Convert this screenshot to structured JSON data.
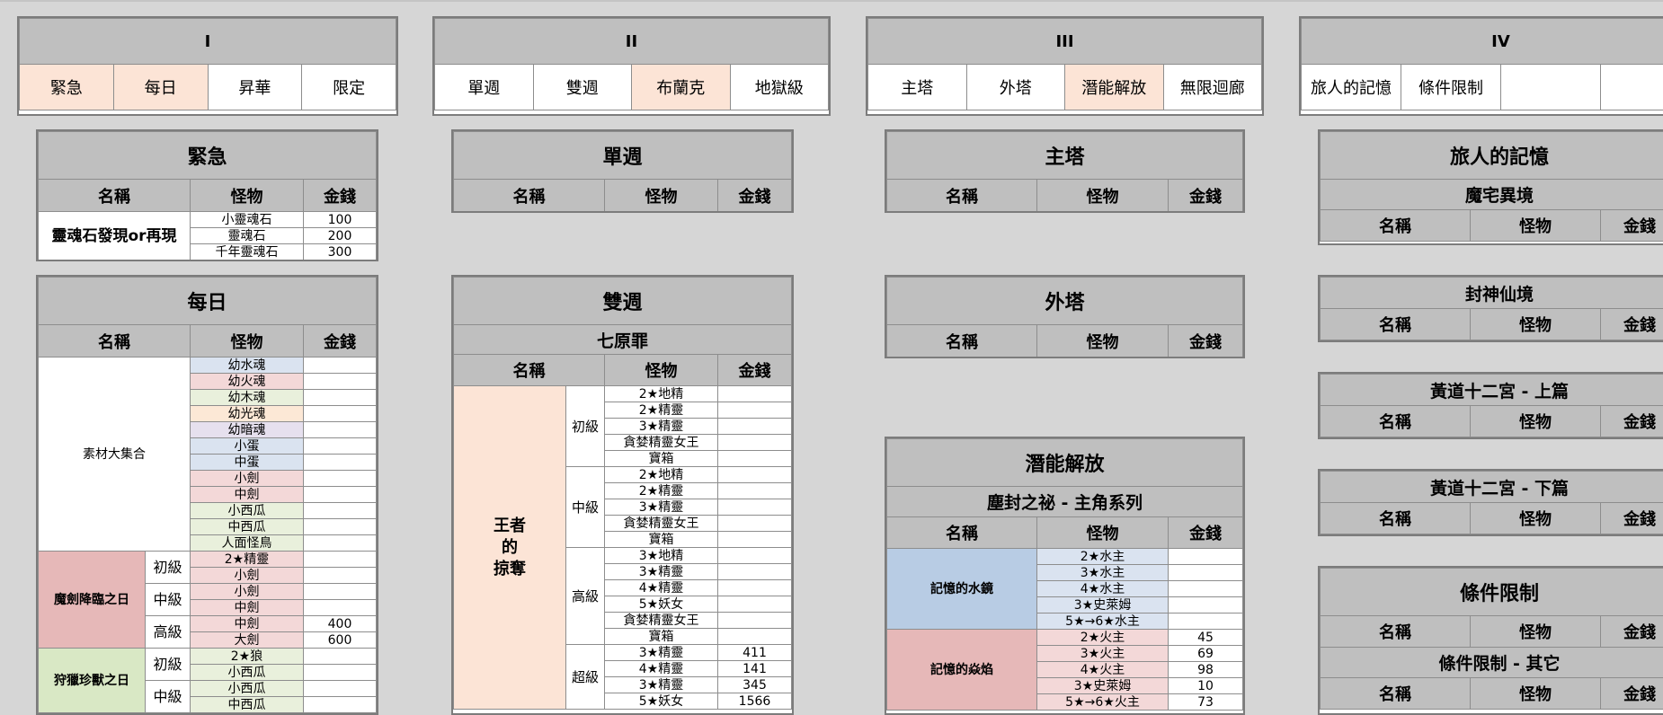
{
  "sections": [
    {
      "title": "I",
      "tabs": [
        "緊急",
        "每日",
        "昇華",
        "限定"
      ]
    },
    {
      "title": "II",
      "tabs": [
        "單週",
        "雙週",
        "布蘭克",
        "地獄級"
      ]
    },
    {
      "title": "III",
      "tabs": [
        "主塔",
        "外塔",
        "潛能解放",
        "無限迴廊"
      ]
    },
    {
      "title": "IV",
      "tabs": [
        "旅人的記憶",
        "條件限制",
        "",
        ""
      ]
    }
  ],
  "columns": {
    "name": "名稱",
    "monster": "怪物",
    "money": "金錢"
  },
  "urgent": {
    "title": "緊急",
    "event": "靈魂石發現or再現",
    "rows": [
      {
        "m": "小靈魂石",
        "v": "100"
      },
      {
        "m": "靈魂石",
        "v": "200"
      },
      {
        "m": "千年靈魂石",
        "v": "300"
      }
    ]
  },
  "daily": {
    "title": "每日",
    "g1": {
      "name": "素材大集合",
      "rows": [
        "幼水魂",
        "幼火魂",
        "幼木魂",
        "幼光魂",
        "幼暗魂",
        "小蛋",
        "中蛋",
        "小劍",
        "中劍",
        "小西瓜",
        "中西瓜",
        "人面怪鳥"
      ]
    },
    "g2": {
      "name": "魔劍降臨之日",
      "levels": [
        {
          "lv": "初級",
          "rows": [
            {
              "m": "2★精靈",
              "v": ""
            },
            {
              "m": "小劍",
              "v": ""
            }
          ]
        },
        {
          "lv": "中級",
          "rows": [
            {
              "m": "小劍",
              "v": ""
            },
            {
              "m": "中劍",
              "v": ""
            }
          ]
        },
        {
          "lv": "高級",
          "rows": [
            {
              "m": "中劍",
              "v": "400"
            },
            {
              "m": "大劍",
              "v": "600"
            }
          ]
        }
      ]
    },
    "g3": {
      "name": "狩獵珍獸之日",
      "levels": [
        {
          "lv": "初級",
          "rows": [
            "2★狼",
            "小西瓜"
          ]
        },
        {
          "lv": "中級",
          "rows": [
            "小西瓜",
            "中西瓜"
          ]
        }
      ]
    }
  },
  "weekly": {
    "title": "單週"
  },
  "biweekly": {
    "title": "雙週",
    "sub": "七原罪",
    "event": "王者\n的\n掠奪",
    "levels": [
      {
        "lv": "初級",
        "rows": [
          {
            "m": "2★地精",
            "v": ""
          },
          {
            "m": "2★精靈",
            "v": ""
          },
          {
            "m": "3★精靈",
            "v": ""
          },
          {
            "m": "貪婪精靈女王",
            "v": ""
          },
          {
            "m": "寶箱",
            "v": ""
          }
        ]
      },
      {
        "lv": "中級",
        "rows": [
          {
            "m": "2★地精",
            "v": ""
          },
          {
            "m": "2★精靈",
            "v": ""
          },
          {
            "m": "3★精靈",
            "v": ""
          },
          {
            "m": "貪婪精靈女王",
            "v": ""
          },
          {
            "m": "寶箱",
            "v": ""
          }
        ]
      },
      {
        "lv": "高級",
        "rows": [
          {
            "m": "3★地精",
            "v": ""
          },
          {
            "m": "3★精靈",
            "v": ""
          },
          {
            "m": "4★精靈",
            "v": ""
          },
          {
            "m": "5★妖女",
            "v": ""
          },
          {
            "m": "貪婪精靈女王",
            "v": ""
          },
          {
            "m": "寶箱",
            "v": ""
          }
        ]
      },
      {
        "lv": "超級",
        "rows": [
          {
            "m": "3★精靈",
            "v": "411"
          },
          {
            "m": "4★精靈",
            "v": "141"
          },
          {
            "m": "3★精靈",
            "v": "345"
          },
          {
            "m": "5★妖女",
            "v": "1566"
          }
        ]
      }
    ]
  },
  "maintower": {
    "title": "主塔"
  },
  "outertower": {
    "title": "外塔"
  },
  "potential": {
    "title": "潛能解放",
    "sub": "塵封之祕 - 主角系列",
    "g1": {
      "name": "記憶的水鏡",
      "rows": [
        {
          "m": "2★水主",
          "v": ""
        },
        {
          "m": "3★水主",
          "v": ""
        },
        {
          "m": "4★水主",
          "v": ""
        },
        {
          "m": "3★史萊姆",
          "v": ""
        },
        {
          "m": "5★→6★水主",
          "v": ""
        }
      ]
    },
    "g2": {
      "name": "記憶的焱焰",
      "rows": [
        {
          "m": "2★火主",
          "v": "45"
        },
        {
          "m": "3★火主",
          "v": "69"
        },
        {
          "m": "4★火主",
          "v": "98"
        },
        {
          "m": "3★史萊姆",
          "v": "10"
        },
        {
          "m": "5★→6★火主",
          "v": "73"
        }
      ]
    }
  },
  "traveler": {
    "title": "旅人的記憶",
    "subs": [
      "魔宅異境",
      "封神仙境",
      "黃道十二宮 - 上篇",
      "黃道十二宮 - 下篇"
    ]
  },
  "condition": {
    "title": "條件限制",
    "sub": "條件限制 - 其它"
  }
}
